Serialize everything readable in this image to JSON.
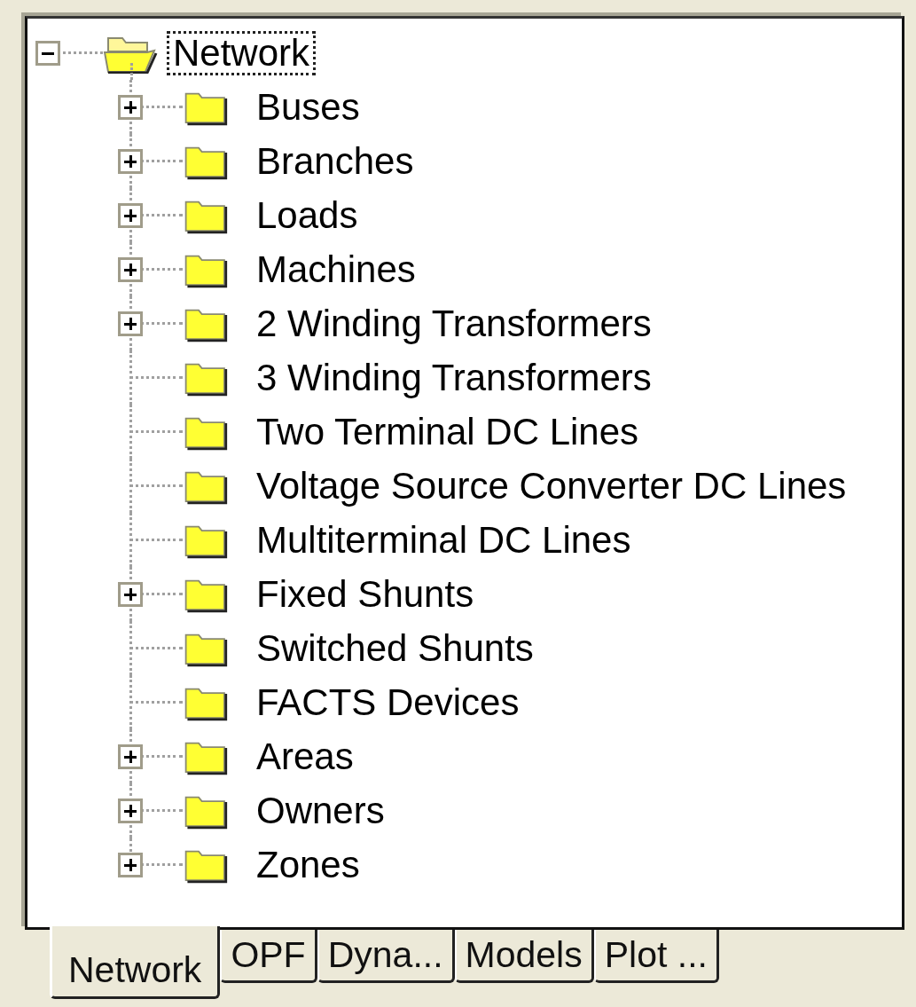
{
  "tree": {
    "label": "Network",
    "expanded": true,
    "selected": true,
    "children": [
      {
        "label": "Buses",
        "expanded": false,
        "selected": false
      },
      {
        "label": "Branches",
        "expanded": false,
        "selected": false
      },
      {
        "label": "Loads",
        "expanded": false,
        "selected": false
      },
      {
        "label": "Machines",
        "expanded": false,
        "selected": false
      },
      {
        "label": "2 Winding Transformers",
        "expanded": false,
        "selected": false
      },
      {
        "label": "3 Winding Transformers",
        "selected": false
      },
      {
        "label": "Two Terminal DC Lines",
        "selected": false
      },
      {
        "label": "Voltage Source Converter DC Lines",
        "selected": false
      },
      {
        "label": "Multiterminal DC Lines",
        "selected": false
      },
      {
        "label": "Fixed Shunts",
        "expanded": false,
        "selected": false
      },
      {
        "label": "Switched Shunts",
        "selected": false
      },
      {
        "label": "FACTS Devices",
        "selected": false
      },
      {
        "label": "Areas",
        "expanded": false,
        "selected": false
      },
      {
        "label": "Owners",
        "expanded": false,
        "selected": false
      },
      {
        "label": "Zones",
        "expanded": false,
        "selected": false
      }
    ]
  },
  "tabs": [
    {
      "label": "Network",
      "selected": true
    },
    {
      "label": "OPF",
      "selected": false
    },
    {
      "label": "Dyna...",
      "selected": false
    },
    {
      "label": "Models",
      "selected": false
    },
    {
      "label": "Plot ...",
      "selected": false
    }
  ]
}
